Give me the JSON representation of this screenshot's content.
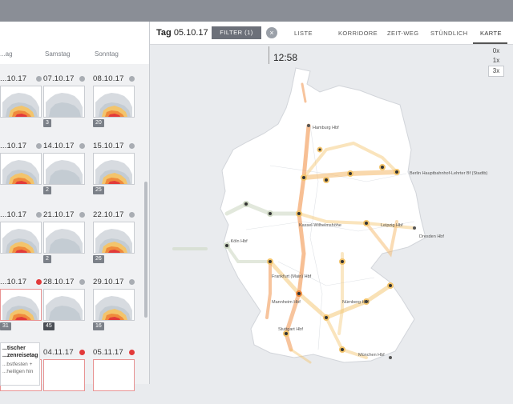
{
  "header": {
    "day_label": "Tag",
    "day_value": "05.10.17",
    "filter_label": "FILTER (1)",
    "clear_glyph": "×"
  },
  "nav": [
    "LISTE",
    "KORRIDORE",
    "ZEIT-WEG",
    "STÜNDLICH",
    "KARTE"
  ],
  "active_nav": "KARTE",
  "clock": "12:58",
  "speed_options": [
    "0x",
    "1x",
    "3x"
  ],
  "speed_selected": "3x",
  "weekday_headers": [
    "...ag",
    "Samstag",
    "Sonntag"
  ],
  "calendar_rows": [
    [
      {
        "date": "...10.17",
        "badge": ""
      },
      {
        "date": "07.10.17",
        "badge": "3"
      },
      {
        "date": "08.10.17",
        "badge": "20"
      }
    ],
    [
      {
        "date": "...10.17",
        "badge": ""
      },
      {
        "date": "14.10.17",
        "badge": "2"
      },
      {
        "date": "15.10.17",
        "badge": "25"
      }
    ],
    [
      {
        "date": "...10.17",
        "badge": ""
      },
      {
        "date": "21.10.17",
        "badge": "2"
      },
      {
        "date": "22.10.17",
        "badge": "26"
      }
    ],
    [
      {
        "date": "...10.17",
        "badge": "31"
      },
      {
        "date": "28.10.17",
        "badge": "45"
      },
      {
        "date": "29.10.17",
        "badge": "16"
      }
    ],
    [
      {
        "date": "",
        "badge": ""
      },
      {
        "date": "04.11.17",
        "badge": ""
      },
      {
        "date": "05.11.17",
        "badge": ""
      }
    ]
  ],
  "tooltip": {
    "title": "...tischer ...zenreisetag",
    "body": "...bstfesten + ...heiligen hin"
  },
  "cities": [
    {
      "name": "Hamburg Hbf"
    },
    {
      "name": "Berlin Hauptbahnhof-Lehrter Bf (Stadtb)"
    },
    {
      "name": "Leipzig Hbf"
    },
    {
      "name": "Kassel-Wilhelmshöhe"
    },
    {
      "name": "...Köln Hbf"
    },
    {
      "name": "Dresden Hbf"
    },
    {
      "name": "Frankfurt (Main) Hbf"
    },
    {
      "name": "Mannheim Hbf"
    },
    {
      "name": "Nürnberg Hbf"
    },
    {
      "name": "Stuttgart Hbf"
    },
    {
      "name": "München Hbf"
    }
  ],
  "colors": {
    "topbar": "#8a8e96",
    "corridor_hot": "#f08a3c",
    "corridor_warm": "#f3c46b",
    "corridor_cool": "#c9d8c2",
    "alert": "#e23a3a"
  }
}
